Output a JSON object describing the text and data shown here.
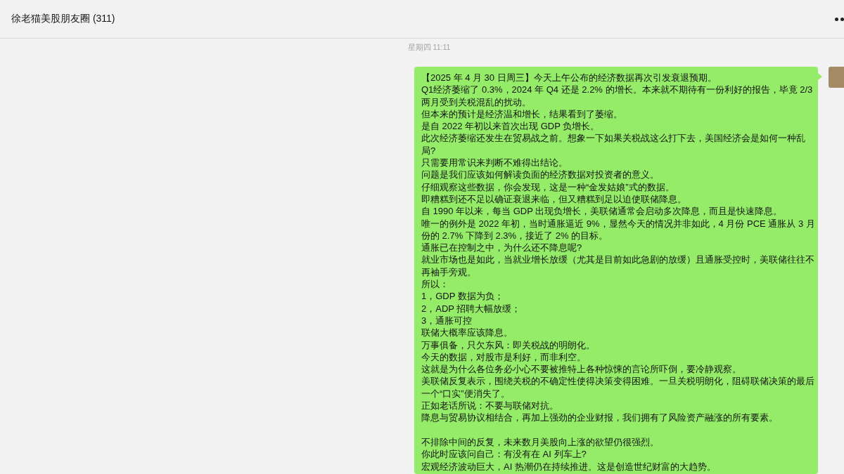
{
  "header": {
    "title": "徐老猫美股朋友圈 (311)"
  },
  "timestamp": "星期四 11:11",
  "message": {
    "sections": [
      {
        "lines": [
          "【2025 年 4 月 30 日周三】今天上午公布的经济数据再次引发衰退预期。",
          "Q1经济萎缩了 0.3%，2024 年 Q4 还是 2.2% 的增长。本来就不期待有一份利好的报告，毕竟 2/3两月受到关税混乱的扰动。",
          "但本来的预计是经济温和增长，结果看到了萎缩。",
          "是自 2022 年初以来首次出现 GDP 负增长。",
          "此次经济萎缩还发生在贸易战之前。想象一下如果关税战这么打下去，美国经济会是如何一种乱局?",
          "只需要用常识来判断不难得出结论。",
          "问题是我们应该如何解读负面的经济数据对投资者的意义。",
          "仔细观察这些数据，你会发现，这是一种“金发姑娘”式的数据。",
          "即糟糕到还不足以确证衰退来临，但又糟糕到足以迫使联储降息。",
          "自 1990 年以来，每当 GDP 出现负增长，美联储通常会启动多次降息，而且是快速降息。",
          "唯一的例外是 2022 年初，当时通胀逼近 9%，显然今天的情况并非如此，4 月份 PCE 通胀从 3 月份的 2.7% 下降到 2.3%，接近了 2% 的目标。",
          "通胀已在控制之中，为什么还不降息呢?",
          "就业市场也是如此，当就业增长放缓（尤其是目前如此急剧的放缓）且通胀受控时，美联储往往不再袖手旁观。",
          "所以：",
          "1，GDP 数据为负；",
          "2，ADP 招聘大幅放缓；",
          "3，通胀可控",
          "联储大概率应该降息。",
          "万事俱备，只欠东风：即关税战的明朗化。",
          "今天的数据，对股市是利好，而非利空。",
          "这就是为什么各位务必小心不要被推特上各种惊悚的言论所吓倒，要冷静观察。",
          "美联储反复表示，围绕关税的不确定性使得决策变得困难。一旦关税明朗化，阻碍联储决策的最后一个“口实”便消失了。",
          "正如老话所说：不要与联储对抗。",
          "降息与贸易协议相结合，再加上强劲的企业财报，我们拥有了风险资产融涨的所有要素。"
        ]
      },
      {
        "lines": [
          "不排除中间的反复，未来数月美股向上涨的欲望仍很强烈。",
          "你此时应该问自己：有没有在 AI 列车上?",
          "宏观经济波动巨大，AI 热潮仍在持续推进。这是创造世纪财富的大趋势。"
        ]
      }
    ]
  }
}
